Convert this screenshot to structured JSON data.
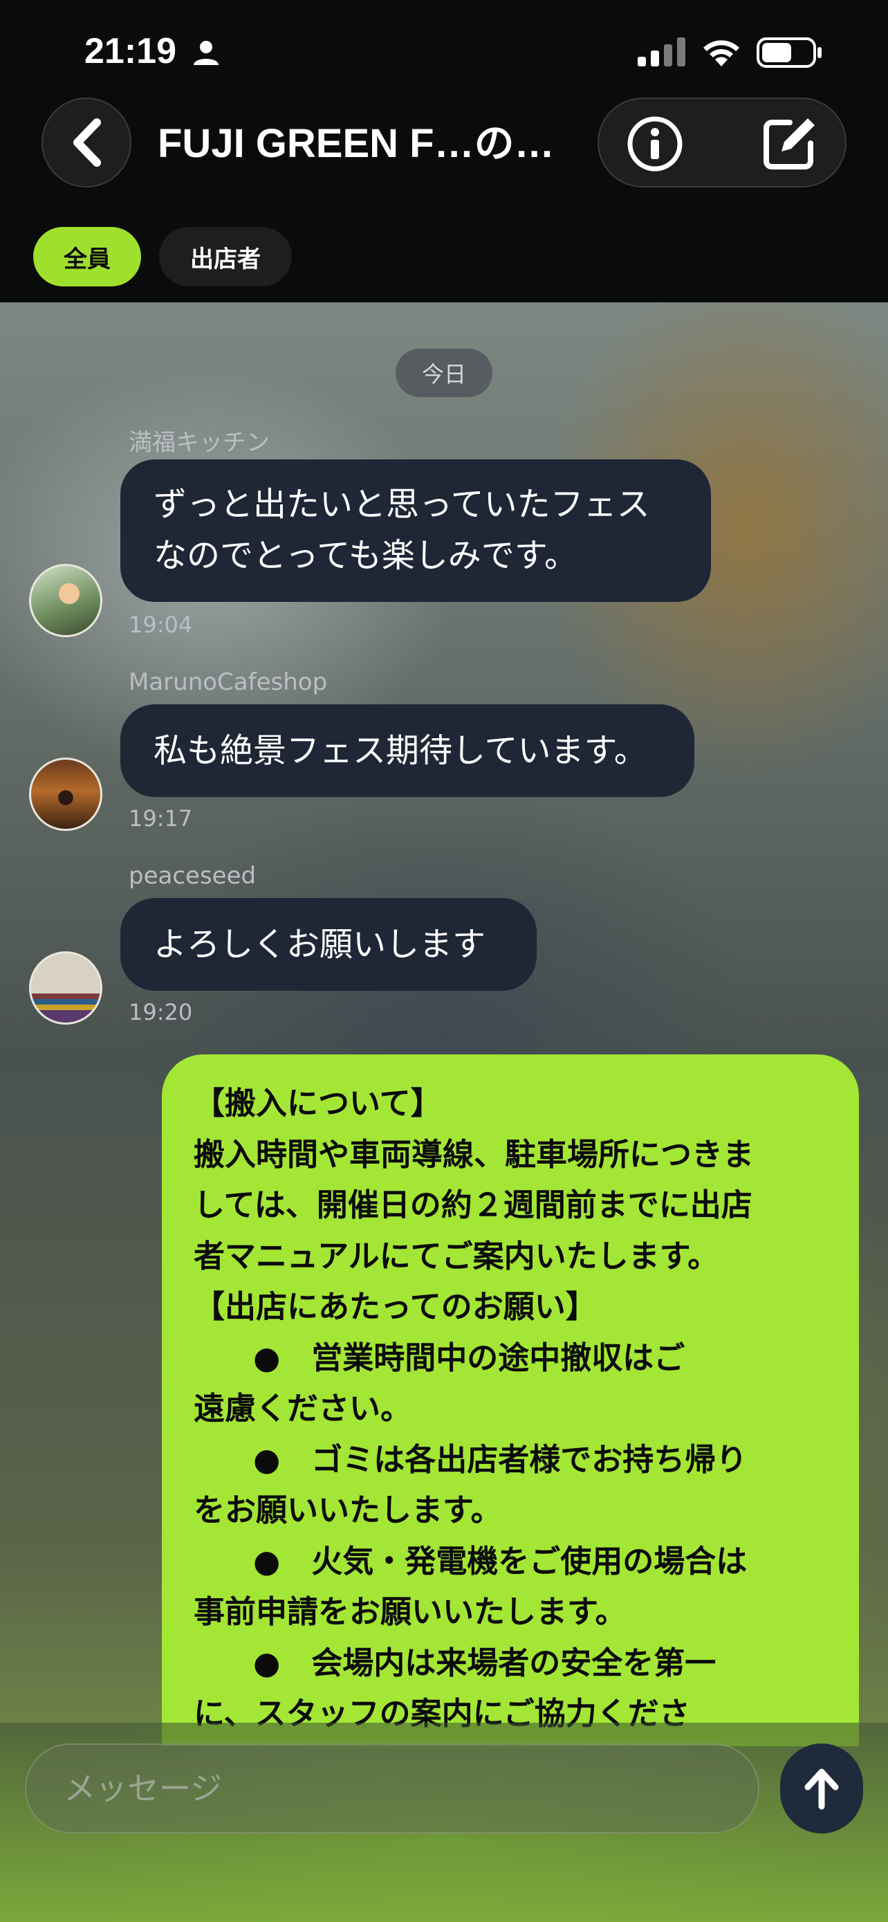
{
  "status_bar": {
    "time": "21:19",
    "battery_level": 0.6
  },
  "header": {
    "title": "FUJI GREEN F…の…"
  },
  "tabs": [
    {
      "label": "全員",
      "selected": true
    },
    {
      "label": "出店者",
      "selected": false
    }
  ],
  "date_divider": "今日",
  "messages": [
    {
      "sender": "満福キッチン",
      "lines": [
        "ずっと出たいと思っていたフェス",
        "なのでとっても楽しみです。"
      ],
      "time": "19:04"
    },
    {
      "sender": "MarunoCafeshop",
      "lines": [
        "私も絶景フェス期待しています。"
      ],
      "time": "19:17"
    },
    {
      "sender": "peaceseed",
      "lines": [
        "よろしくお願いします"
      ],
      "time": "19:20"
    }
  ],
  "my_message": {
    "lines": [
      "【搬入について】",
      "搬入時間や車両導線、駐車場所につきま",
      "しては、開催日の約２週間前までに出店",
      "者マニュアルにてご案内いたします。",
      "【出店にあたってのお願い】",
      "●　営業時間中の途中撤収はご",
      "遠慮ください。",
      "●　ゴミは各出店者様でお持ち帰り",
      "をお願いいたします。",
      "●　火気・発電機をご使用の場合は",
      "事前申請をお願いいたします。",
      "●　会場内は来場者の安全を第一",
      "に、スタッフの案内にご協力くださ"
    ]
  },
  "composer": {
    "placeholder": "メッセージ"
  },
  "colors": {
    "accent": "#a3e635",
    "header_bg": "#0a0b0b",
    "bubble_bg": "#1f2636"
  }
}
